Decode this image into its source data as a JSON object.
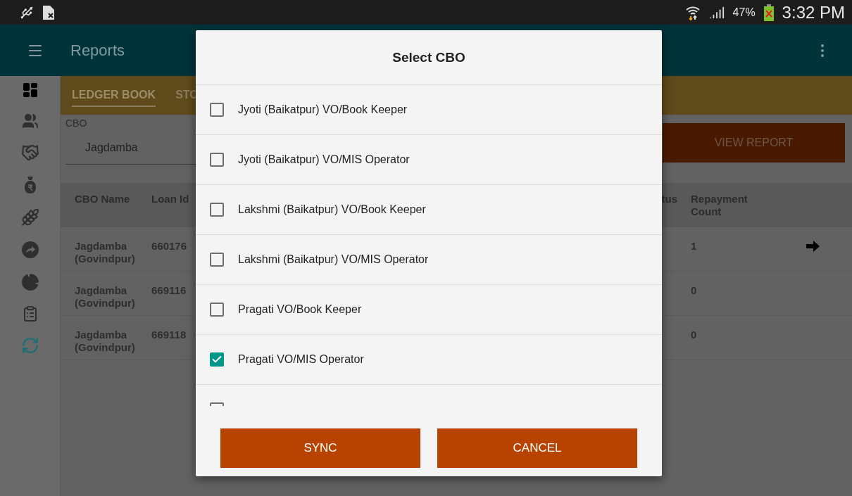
{
  "status_bar": {
    "battery": "47%",
    "time": "3:32 PM"
  },
  "app_bar": {
    "title": "Reports"
  },
  "sidebar": {
    "items": [
      {
        "kind": "dashboard",
        "selected": true
      },
      {
        "kind": "group",
        "selected": false
      },
      {
        "kind": "handshake",
        "selected": false
      },
      {
        "kind": "moneybag",
        "selected": false
      },
      {
        "kind": "wheat",
        "selected": false
      },
      {
        "kind": "forward",
        "selected": false
      },
      {
        "kind": "pie",
        "selected": false
      },
      {
        "kind": "clipboard",
        "selected": false
      },
      {
        "kind": "sync",
        "selected": false
      }
    ]
  },
  "tabs": [
    {
      "label": "LEDGER BOOK",
      "selected": true
    },
    {
      "label": "STO",
      "selected": false
    }
  ],
  "cbo_field": {
    "label": "CBO",
    "value": "Jagdamba"
  },
  "view_report_button": "VIEW REPORT",
  "table": {
    "columns": [
      "CBO Name",
      "Loan Id",
      "tus",
      "Repayment Count"
    ],
    "rows": [
      {
        "cbo_name": "Jagdamba (Govindpur)",
        "loan_id": "660176",
        "repayment_count": "1",
        "has_arrow": true
      },
      {
        "cbo_name": "Jagdamba (Govindpur)",
        "loan_id": "669116",
        "repayment_count": "0",
        "has_arrow": false
      },
      {
        "cbo_name": "Jagdamba (Govindpur)",
        "loan_id": "669118",
        "repayment_count": "0",
        "has_arrow": false
      }
    ]
  },
  "dialog": {
    "title": "Select CBO",
    "items": [
      {
        "label": "Jyoti (Baikatpur) VO/Book Keeper",
        "checked": false
      },
      {
        "label": "Jyoti (Baikatpur) VO/MIS Operator",
        "checked": false
      },
      {
        "label": "Lakshmi (Baikatpur) VO/Book Keeper",
        "checked": false
      },
      {
        "label": "Lakshmi (Baikatpur) VO/MIS Operator",
        "checked": false
      },
      {
        "label": "Pragati VO/Book Keeper",
        "checked": false
      },
      {
        "label": "Pragati VO/MIS Operator",
        "checked": true
      },
      {
        "checked": false
      }
    ],
    "buttons": [
      "SYNC",
      "CANCEL"
    ]
  }
}
